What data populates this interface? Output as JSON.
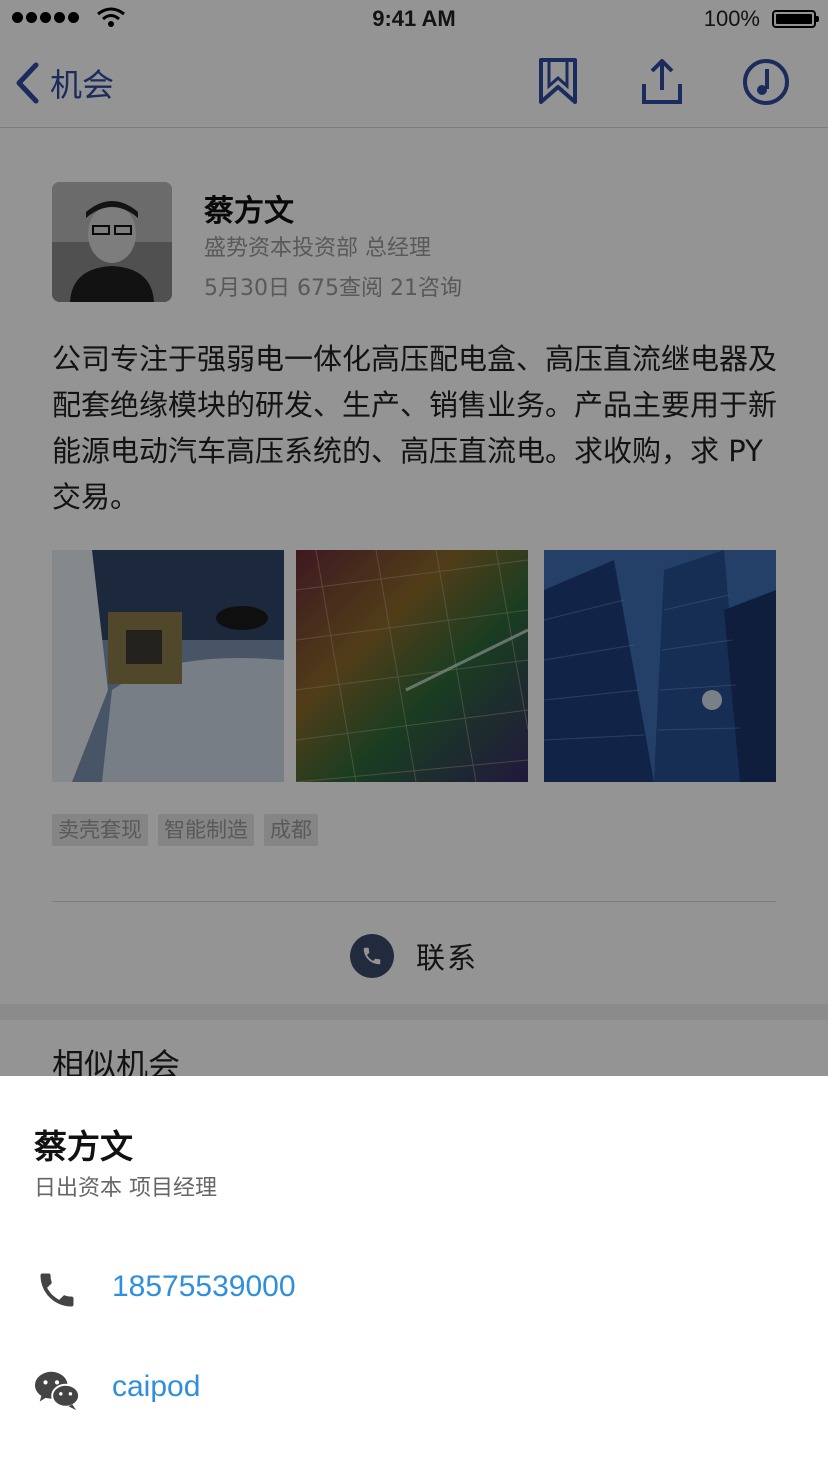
{
  "status_bar": {
    "time": "9:41 AM",
    "battery": "100%"
  },
  "nav": {
    "back_label": "机会"
  },
  "post": {
    "author_name": "蔡方文",
    "author_title": "盛势资本投资部 总经理",
    "meta": "5月30日  675查阅  21咨询",
    "description": "公司专注于强弱电一体化高压配电盒、高压直流继电器及配套绝缘模块的研发、生产、销售业务。产品主要用于新能源电动汽车高压系统的、高压直流电。求收购，求 PY 交易。",
    "tags": [
      "卖壳套现",
      "智能制造",
      "成都"
    ],
    "contact_label": "联系"
  },
  "similar_title": "相似机会",
  "sheet": {
    "name": "蔡方文",
    "title": "日出资本 项目经理",
    "phone": "18575539000",
    "wechat": "caipod"
  },
  "colors": {
    "accent": "#2f4aa0",
    "link": "#2f8fdd",
    "overlay": "rgba(0,0,0,0.42)"
  },
  "icons": [
    "back-chevron-icon",
    "bookmark-icon",
    "share-icon",
    "music-icon",
    "phone-icon",
    "wechat-icon"
  ]
}
